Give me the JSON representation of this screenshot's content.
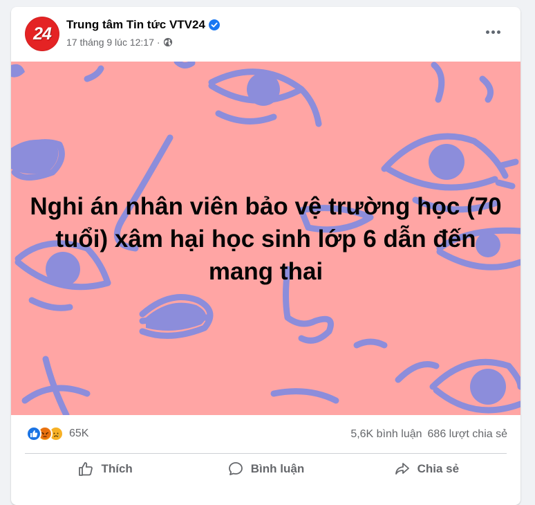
{
  "post": {
    "page_name": "Trung tâm Tin tức VTV24",
    "avatar_text": "24",
    "timestamp": "17 tháng 9 lúc 12:17",
    "meta_separator": "·",
    "headline": "Nghi án nhân viên bảo vệ trường học (70 tuổi) xâm hại học sinh lớp 6 dẫn đến mang thai",
    "image_background": "#ffa5a4",
    "art_color": "#8c8ddb"
  },
  "stats": {
    "reaction_icons": [
      "like-reaction-icon",
      "angry-reaction-icon",
      "sad-reaction-icon"
    ],
    "reaction_count": "65K",
    "comments": "5,6K bình luận",
    "shares": "686 lượt chia sẻ"
  },
  "actions": {
    "like_label": "Thích",
    "comment_label": "Bình luận",
    "share_label": "Chia sẻ"
  }
}
